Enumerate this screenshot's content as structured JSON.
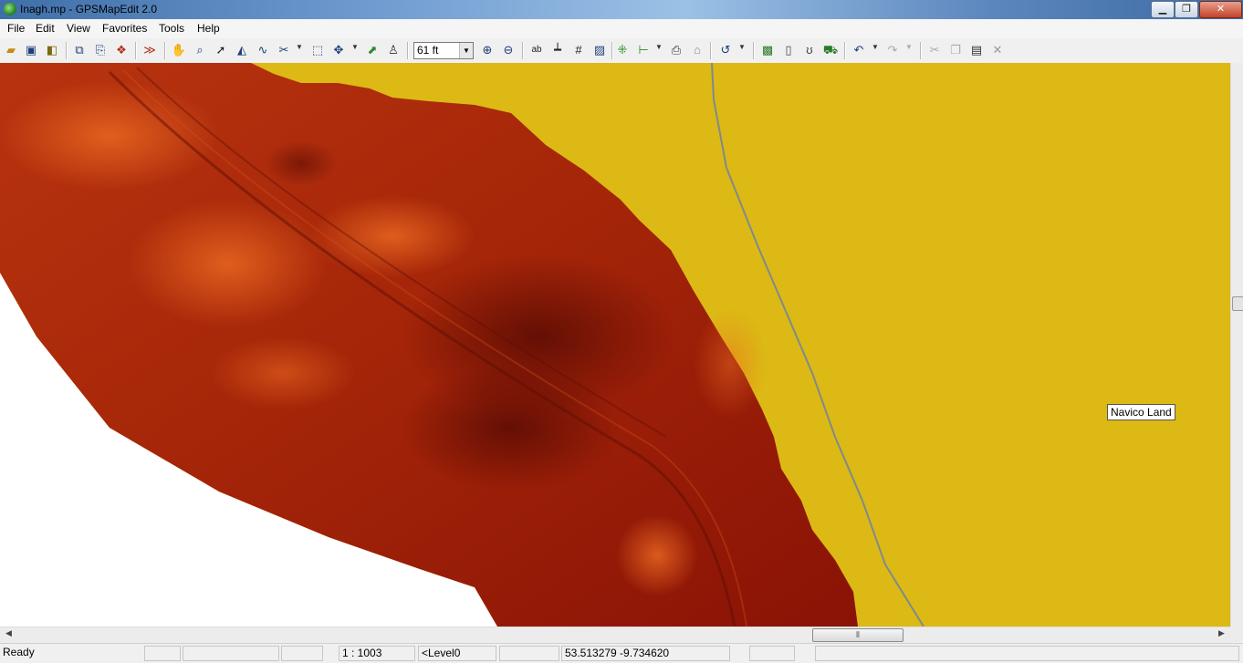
{
  "window": {
    "title": "Inagh.mp - GPSMapEdit 2.0",
    "minimize": "▁",
    "maximize": "❐",
    "close": "✕"
  },
  "menu": [
    "File",
    "Edit",
    "View",
    "Favorites",
    "Tools",
    "Help"
  ],
  "toolbar": {
    "zoom_value": "61 ft",
    "icons": [
      "open-icon",
      "save-icon",
      "import-icon",
      "properties-icon",
      "export-icon",
      "layers-icon",
      "trace-icon",
      "hand-pan-icon",
      "zoom-rect-icon",
      "select-arrow-icon",
      "edit-nodes-icon",
      "polyline-icon",
      "scissors-icon",
      "select-rect-icon",
      "move-icon",
      "add-point-icon",
      "measure-icon",
      "zoom-in-icon",
      "zoom-out-icon",
      "label-ab-icon",
      "ruler-icon",
      "grid-icon",
      "hatch-icon",
      "nodes-icon",
      "transform-icon",
      "screenshot-icon",
      "house-icon",
      "lasso-icon",
      "map-view-icon",
      "blank-page-icon",
      "measure-r-icon",
      "route-icon",
      "undo-icon",
      "redo-icon",
      "cut-icon",
      "copy-icon",
      "paste-icon",
      "delete-icon"
    ]
  },
  "colors": {
    "land": "#dcb914",
    "sonar_dark": "#8a1306",
    "sonar_mid": "#b52d0c",
    "sonar_light": "#e0591a",
    "road_line": "#7f8a8e"
  },
  "map": {
    "label": "Navico Land"
  },
  "status": {
    "ready": "Ready",
    "scale": "1 : 1003",
    "level": "<Level0",
    "coords": "53.513279 -9.734620"
  }
}
